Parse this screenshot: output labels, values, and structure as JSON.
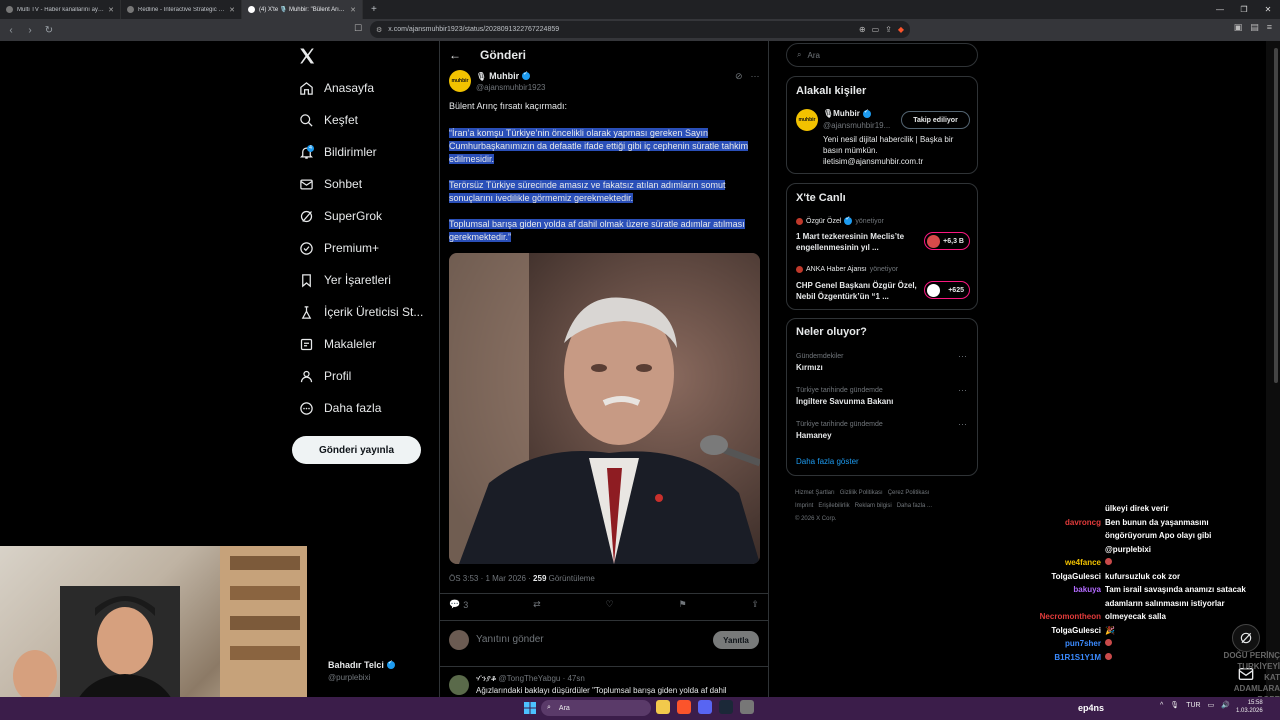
{
  "browser": {
    "tabs": [
      {
        "label": "Multi TV - Haber kanallarını aynı and..."
      },
      {
        "label": "Redline - Interactive Strategic Map"
      },
      {
        "label": "(4) X'te 🎙️ Muhbir: \"Bülent Arınç..."
      }
    ],
    "url": "x.com/ajansmuhbir1923/status/2028091322767224859"
  },
  "nav": {
    "items": [
      {
        "label": "Anasayfa"
      },
      {
        "label": "Keşfet"
      },
      {
        "label": "Bildirimler"
      },
      {
        "label": "Sohbet"
      },
      {
        "label": "SuperGrok"
      },
      {
        "label": "Premium+"
      },
      {
        "label": "Yer İşaretleri"
      },
      {
        "label": "İçerik Üreticisi St..."
      },
      {
        "label": "Makaleler"
      },
      {
        "label": "Profil"
      },
      {
        "label": "Daha fazla"
      }
    ],
    "notif_badge": "4",
    "post_button": "Gönderi yayınla",
    "profile": {
      "name": "Bahadır Telci",
      "handle": "@purplebixi"
    }
  },
  "post": {
    "page_title": "Gönderi",
    "avatar_text": "muhbir",
    "author": "Muhbir",
    "handle": "@ajansmuhbir1923",
    "lead": "Bülent Arınç fırsatı kaçırmadı:",
    "paragraphs": [
      "“İran’a komşu Türkiye’nin öncelikli olarak yapması gereken Sayın Cumhurbaşkanımızın da defaatle ifade ettiği gibi iç cephenin süratle tahkim edilmesidir.",
      "Terörsüz Türkiye sürecinde amasız ve fakatsız atılan adımların somut sonuçlarını ivedilikle görmemiz gerekmektedir.",
      "Toplumsal barışa giden yolda af dahil olmak üzere süratle adımlar atılması gerekmektedir.”"
    ],
    "time": "ÖS 3:53 · 1 Mar 2026 · ",
    "views": "259",
    "views_label": " Görüntüleme",
    "reply_count": "3",
    "reply_placeholder": "Yanıtını gönder",
    "reply_button": "Yanıtla"
  },
  "reply": {
    "name": "ሃ'ንያቆ",
    "handle": "@TongTheYabgu · 47sn",
    "text": "Ağızlarındaki baklayı düşürdüler \"Toplumsal barışa giden yolda af dahil"
  },
  "sidebar": {
    "search_placeholder": "Ara",
    "related": {
      "title": "Alakalı kişiler",
      "name": "Muhbir",
      "handle": "@ajansmuhbir19...",
      "follow": "Takip ediliyor",
      "bio": "Yeni nesil dijital habercilik | Başka bir basın mümkün. iletisim@ajansmuhbir.com.tr"
    },
    "live": {
      "title": "X'te Canlı",
      "items": [
        {
          "host": "Özgür Özel",
          "role": "yönetiyor",
          "title": "1 Mart tezkeresinin Meclis’te engellenmesinin yıl ...",
          "count": "+6,3 B"
        },
        {
          "host": "ANKA Haber Ajansı",
          "role": "yönetiyor",
          "title": "CHP Genel Başkanı Özgür Özel, Nebil Özgentürk’ün “1 ...",
          "count": "+625"
        }
      ]
    },
    "trends": {
      "title": "Neler oluyor?",
      "items": [
        {
          "context": "Gündemdekiler",
          "name": "Kırmızı"
        },
        {
          "context": "Türkiye tarihinde gündemde",
          "name": "İngiltere Savunma Bakanı"
        },
        {
          "context": "Türkiye tarihinde gündemde",
          "name": "Hamaney"
        }
      ],
      "show_more": "Daha fazla göster"
    },
    "footer": [
      "Hizmet Şartları",
      "Gizlilik Politikası",
      "Çerez Politikası",
      "Imprint",
      "Erişilebilirlik",
      "Reklam bilgisi",
      "Daha fazla ...",
      "© 2026 X Corp."
    ]
  },
  "chat": [
    {
      "user": "",
      "color": "#ffffff",
      "msg": "ülkeyi direk verir"
    },
    {
      "user": "davroncg",
      "color": "#e23b3b",
      "msg": "Ben bunun da yaşanmasını"
    },
    {
      "user": "",
      "color": "#ffffff",
      "msg": "öngörüyorum Apo olayı gibi"
    },
    {
      "user": "",
      "color": "#ffffff",
      "msg": "@purplebixi"
    },
    {
      "user": "we4fance",
      "color": "#f2c200",
      "msg": ""
    },
    {
      "user": "TolgaGulesci",
      "color": "#ffffff",
      "msg": "kufursuzluk cok zor"
    },
    {
      "user": "bakuya",
      "color": "#b36bff",
      "msg": "Tam israil savaşında anamızı satacak"
    },
    {
      "user": "",
      "color": "#ffffff",
      "msg": "adamların salınmasını istiyorlar"
    },
    {
      "user": "Necromontheon",
      "color": "#e23b3b",
      "msg": "olmeyecak salla"
    },
    {
      "user": "TolgaGulesci",
      "color": "#ffffff",
      "msg": "🎉"
    },
    {
      "user": "pun7sher",
      "color": "#3b8bff",
      "msg": ""
    },
    {
      "user": "B1R1S1Y1M",
      "color": "#3b8bff",
      "msg": ""
    }
  ],
  "overlay_right": "DOĞU PERİNÇ TURKİYEYİ KAT ADAMLARA ROPE FETULLAHÇIL",
  "taskbar": {
    "search": "Ara",
    "user": "ep4ns",
    "lang": "TUR",
    "time": "15:58",
    "date": "1.03.2026"
  },
  "colors": {
    "accent": "#1d9bf0",
    "selection": "#2a4fb8",
    "live": "#f91880"
  }
}
